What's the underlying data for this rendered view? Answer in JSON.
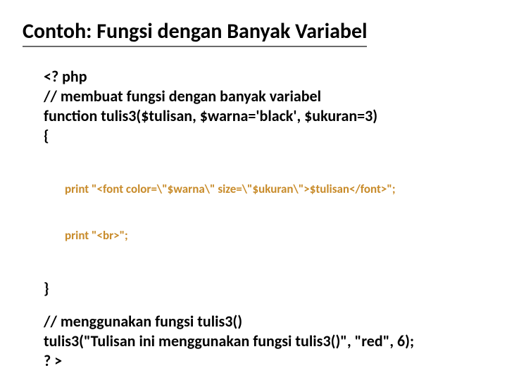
{
  "title": "Contoh: Fungsi dengan Banyak Variabel",
  "code": {
    "l1": "<? php",
    "l2": "// membuat fungsi dengan banyak variabel",
    "l3": "function tulis3($tulisan, $warna='black', $ukuran=3)",
    "l4": "{",
    "inner1": "print \"<font color=\\\"$warna\\\" size=\\\"$ukuran\\\">$tulisan</font>\";",
    "inner2": "print \"<br>\";",
    "l5": "}",
    "l6": "// menggunakan fungsi tulis3()",
    "l7": "tulis3(\"Tulisan ini menggunakan fungsi tulis3()\", \"red\", 6);",
    "l8": "? >"
  }
}
